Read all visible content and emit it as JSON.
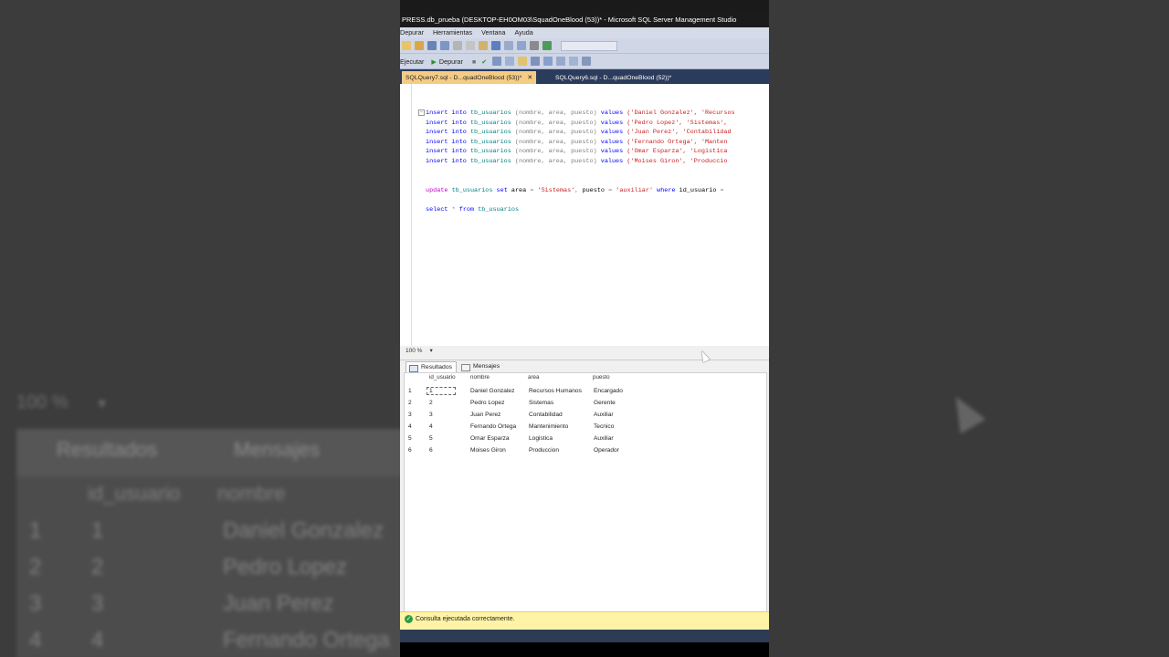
{
  "window": {
    "title": "PRESS.db_prueba (DESKTOP-EH0OM03\\SquadOneBlood (53))* - Microsoft SQL Server Management Studio"
  },
  "menubar": [
    "Depurar",
    "Herramientas",
    "Ventana",
    "Ayuda"
  ],
  "toolbar2": {
    "execute_label": "Ejecutar",
    "debug_label": "Depurar"
  },
  "doc_tabs": [
    {
      "label": "SQLQuery7.sql - D...quadOneBlood (53))*",
      "close": "✕"
    },
    {
      "label": "SQLQuery6.sql - D...quadOneBlood (52))*"
    }
  ],
  "editor": {
    "insert_prefix": "insert into ",
    "table": "tb_usuarios",
    "columns": " (nombre, area, puesto) ",
    "values_kw": "values",
    "insert_values": [
      "('Daniel Gonzalez', 'Recursos",
      "('Pedro Lopez', 'Sistemas',",
      "('Juan Perez', 'Contabilidad",
      "('Fernando Ortega', 'Manten",
      "('Omar Esparza', 'Logistica",
      "('Moises Giron', 'Produccio"
    ],
    "update_line": {
      "kw": "update",
      "table": "tb_usuarios",
      "set": "set",
      "col1": "area",
      "eq": "=",
      "val1": "'Sistemas'",
      "comma": ",",
      "col2": "puesto",
      "val2": "'auxiliar'",
      "where": "where",
      "col3": "id_usuario",
      "tail": "="
    },
    "select_line": {
      "kw": "select",
      "star": "*",
      "from": "from",
      "table": "tb_usuarios"
    }
  },
  "zoom": "100 %",
  "result_tabs": [
    "Resultados",
    "Mensajes"
  ],
  "results": {
    "columns": [
      "id_usuario",
      "nombre",
      "area",
      "puesto"
    ],
    "rows": [
      {
        "n": "1",
        "id": "1",
        "nombre": "Daniel Gonzalez",
        "area": "Recursos Humanos",
        "puesto": "Encargado"
      },
      {
        "n": "2",
        "id": "2",
        "nombre": "Pedro Lopez",
        "area": "Sistemas",
        "puesto": "Gerente"
      },
      {
        "n": "3",
        "id": "3",
        "nombre": "Juan Perez",
        "area": "Contabilidad",
        "puesto": "Auxiliar"
      },
      {
        "n": "4",
        "id": "4",
        "nombre": "Fernando Ortega",
        "area": "Mantenimiento",
        "puesto": "Tecnico"
      },
      {
        "n": "5",
        "id": "5",
        "nombre": "Omar Esparza",
        "area": "Logistica",
        "puesto": "Auxiliar"
      },
      {
        "n": "6",
        "id": "6",
        "nombre": "Moises Giron",
        "area": "Produccion",
        "puesto": "Operador"
      }
    ]
  },
  "status": {
    "text": "Consulta ejecutada correctamente.",
    "icon": "✓"
  },
  "background": {
    "zoom": "100 %",
    "tabs": [
      "Resultados",
      "Mensajes"
    ],
    "headers": [
      "id_usuario",
      "nombre"
    ],
    "rows": [
      {
        "n": "1",
        "id": "1",
        "nombre": "Daniel Gonzalez"
      },
      {
        "n": "2",
        "id": "2",
        "nombre": "Pedro Lopez"
      },
      {
        "n": "3",
        "id": "3",
        "nombre": "Juan Perez"
      },
      {
        "n": "4",
        "id": "4",
        "nombre": "Fernando Ortega"
      }
    ]
  }
}
